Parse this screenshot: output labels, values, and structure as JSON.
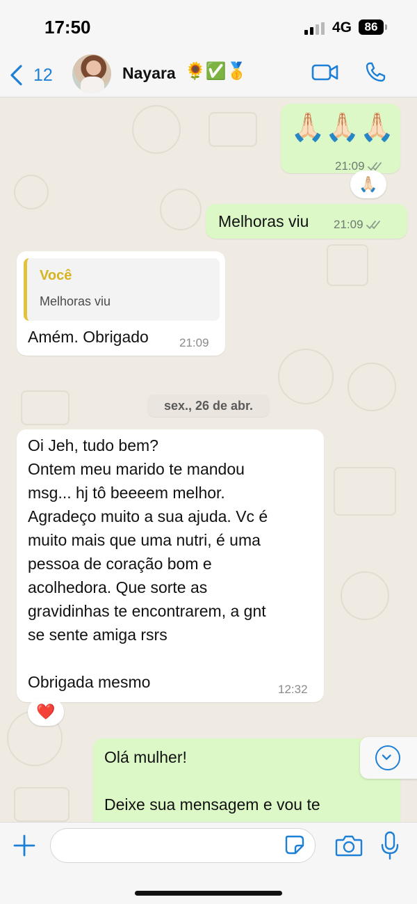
{
  "status_bar": {
    "time": "17:50",
    "network": "4G",
    "battery": "86"
  },
  "header": {
    "back_count": "12",
    "contact_name": "Nayara",
    "name_emoji": "🌻✅🥇"
  },
  "messages": {
    "m1": {
      "text": "🙏🏻🙏🏻🙏🏻",
      "time": "21:09",
      "reaction": "🙏🏻"
    },
    "m2": {
      "text": "Melhoras viu",
      "time": "21:09"
    },
    "m3": {
      "quote_author": "Você",
      "quote_text": "Melhoras viu",
      "text": "Amém. Obrigado",
      "time": "21:09"
    },
    "date_divider": "sex., 26 de abr.",
    "m4": {
      "lines": [
        "Oi Jeh, tudo bem?",
        "Ontem meu marido te mandou",
        "msg... hj tô beeeem melhor.",
        "Agradeço muito a sua ajuda. Vc é",
        "muito mais que uma nutri, é uma",
        "pessoa de coração bom e",
        "acolhedora. Que sorte as",
        "gravidinhas te encontrarem, a gnt",
        "se sente amiga rsrs",
        "",
        "Obrigada mesmo"
      ],
      "time": "12:32",
      "reaction": "❤️"
    },
    "m5": {
      "lines": [
        "Olá mulher!",
        "",
        "Deixe sua mensagem e vou te"
      ]
    }
  },
  "icons": {
    "back": "chevron-left-icon",
    "video": "video-call-icon",
    "phone": "phone-icon",
    "read": "double-check-icon",
    "scroll_down": "chevron-down-icon",
    "plus": "plus-icon",
    "sticker": "sticker-icon",
    "camera": "camera-icon",
    "mic": "microphone-icon"
  },
  "colors": {
    "accent": "#1d7fd6",
    "outgoing_bubble": "#dbf8c6",
    "incoming_bubble": "#ffffff",
    "chat_background": "#efeae2",
    "quote_author": "#d6b31f"
  }
}
